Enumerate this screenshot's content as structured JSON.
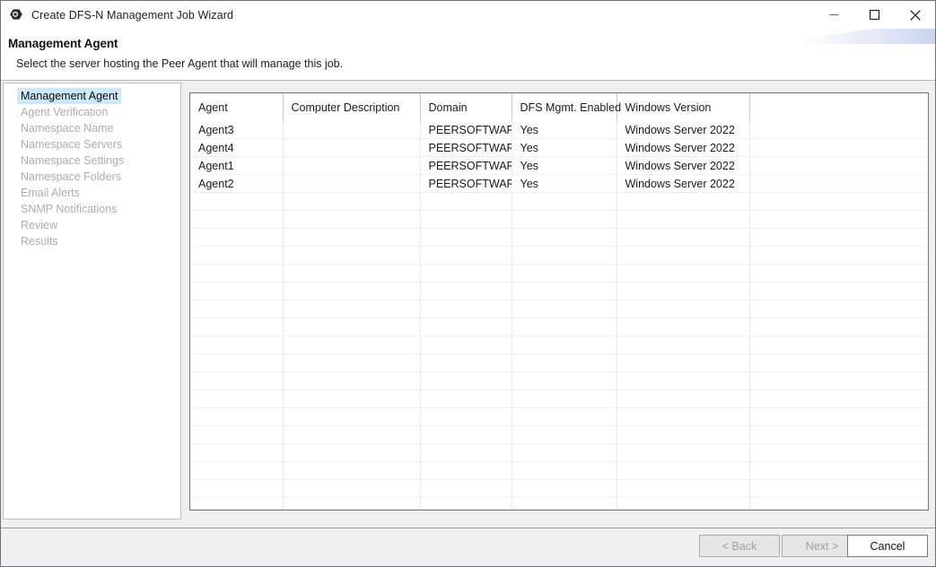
{
  "window": {
    "title": "Create DFS-N Management Job Wizard",
    "app_icon": "peer-hexagon-icon",
    "controls": {
      "minimize": "minimize-icon",
      "maximize": "maximize-icon",
      "close": "close-icon"
    }
  },
  "header": {
    "title": "Management Agent",
    "subtitle": "Select the server hosting the Peer Agent that will manage this job."
  },
  "sidebar": {
    "items": [
      {
        "label": "Management Agent",
        "state": "active"
      },
      {
        "label": "Agent Verification",
        "state": "disabled"
      },
      {
        "label": "Namespace Name",
        "state": "disabled"
      },
      {
        "label": "Namespace Servers",
        "state": "disabled"
      },
      {
        "label": "Namespace Settings",
        "state": "disabled"
      },
      {
        "label": "Namespace Folders",
        "state": "disabled"
      },
      {
        "label": "Email Alerts",
        "state": "disabled"
      },
      {
        "label": "SNMP Notifications",
        "state": "disabled"
      },
      {
        "label": "Review",
        "state": "disabled"
      },
      {
        "label": "Results",
        "state": "disabled"
      }
    ]
  },
  "table": {
    "columns": [
      "Agent",
      "Computer Description",
      "Domain",
      "DFS Mgmt. Enabled",
      "Windows Version",
      ""
    ],
    "rows": [
      [
        "Agent3",
        "",
        "PEERSOFTWARE",
        "Yes",
        "Windows Server 2022",
        ""
      ],
      [
        "Agent4",
        "",
        "PEERSOFTWARE",
        "Yes",
        "Windows Server 2022",
        ""
      ],
      [
        "Agent1",
        "",
        "PEERSOFTWARE",
        "Yes",
        "Windows Server 2022",
        ""
      ],
      [
        "Agent2",
        "",
        "PEERSOFTWARE",
        "Yes",
        "Windows Server 2022",
        ""
      ]
    ],
    "empty_row_count": 18
  },
  "footer": {
    "back_label": "< Back",
    "back_enabled": false,
    "next_label": "Next >",
    "next_enabled": false,
    "cancel_label": "Cancel",
    "cancel_enabled": true
  },
  "colors": {
    "selection_blue": "#cde8f7",
    "accent_blue": "#1d4f73",
    "swoosh_blue": "#c9d4ef",
    "chrome_gray": "#f0f0f0",
    "disabled_text": "#adadad"
  }
}
